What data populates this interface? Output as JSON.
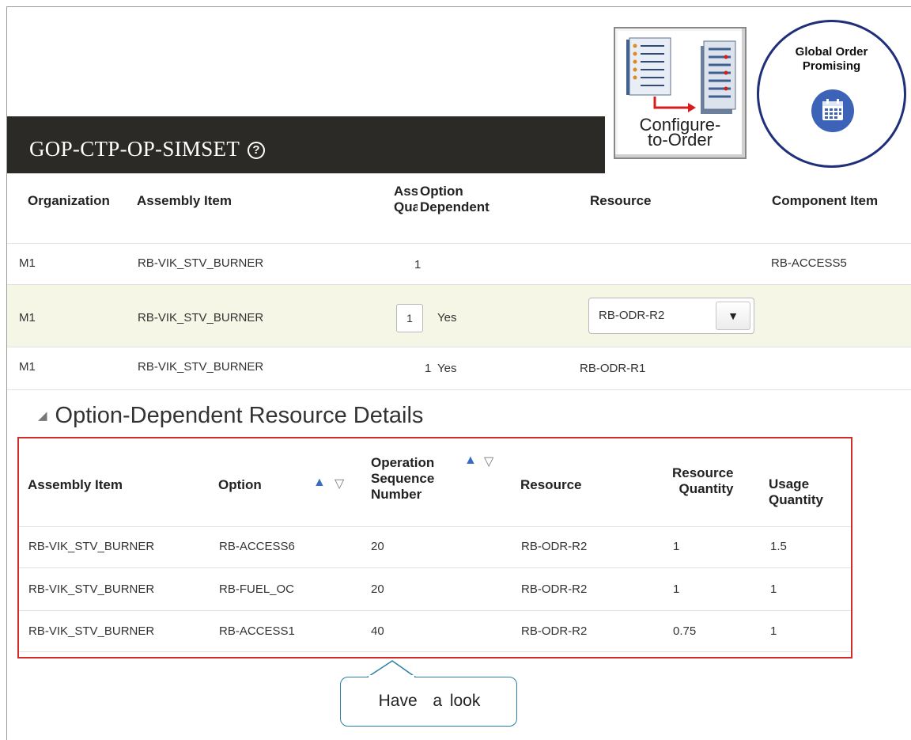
{
  "page_title": "GOP-CTP-OP-SIMSET",
  "help_glyph": "?",
  "cto_badge_label": "Configure-\nto-Order",
  "gop_badge_label": "Global Order\nPromising",
  "main_table": {
    "headers": {
      "organization": "Organization",
      "assembly_item": "Assembly Item",
      "assembly_qty_l1": "Ass",
      "assembly_qty_l2": "Qua",
      "option_dep_l1": "Option",
      "option_dep_l2": "Dependent",
      "resource": "Resource",
      "component_item": "Component Item"
    },
    "rows": [
      {
        "organization": "M1",
        "assembly_item": "RB-VIK_STV_BURNER",
        "qty": "1",
        "option_dependent": "",
        "resource": "",
        "component_item": "RB-ACCESS5"
      },
      {
        "organization": "M1",
        "assembly_item": "RB-VIK_STV_BURNER",
        "qty": "1",
        "option_dependent": "Yes",
        "resource": "RB-ODR-R2",
        "component_item": ""
      },
      {
        "organization": "M1",
        "assembly_item": "RB-VIK_STV_BURNER",
        "qty": "1",
        "option_dependent": "Yes",
        "resource": "RB-ODR-R1",
        "component_item": ""
      }
    ]
  },
  "section_title": "Option-Dependent Resource Details",
  "detail_table": {
    "headers": {
      "assembly_item": "Assembly Item",
      "option": "Option",
      "op_seq_l1": "Operation",
      "op_seq_l2": "Sequence",
      "op_seq_l3": "Number",
      "resource": "Resource",
      "res_qty_l1": "Resource",
      "res_qty_l2": "Quantity",
      "usage_qty_l1": "Usage",
      "usage_qty_l2": "Quantity"
    },
    "rows": [
      {
        "assembly_item": "RB-VIK_STV_BURNER",
        "option": "RB-ACCESS6",
        "op_seq": "20",
        "resource": "RB-ODR-R2",
        "resource_qty": "1",
        "usage_qty": "1.5"
      },
      {
        "assembly_item": "RB-VIK_STV_BURNER",
        "option": "RB-FUEL_OC",
        "op_seq": "20",
        "resource": "RB-ODR-R2",
        "resource_qty": "1",
        "usage_qty": "1"
      },
      {
        "assembly_item": "RB-VIK_STV_BURNER",
        "option": "RB-ACCESS1",
        "op_seq": "40",
        "resource": "RB-ODR-R2",
        "resource_qty": "0.75",
        "usage_qty": "1"
      }
    ]
  },
  "callout_text": "Have  a look",
  "icons": [
    "help-icon",
    "configure-to-order-icon",
    "calendar-icon",
    "dropdown-arrow-icon",
    "collapse-triangle-icon",
    "sort-ascending-icon",
    "sort-descending-icon"
  ],
  "colors": {
    "title_bar": "#2b2a26",
    "highlight_row": "#f5f6e6",
    "annotation_red": "#d22b2b",
    "gop_ring": "#1f2f7a",
    "sort_accent": "#3a6dbf"
  }
}
